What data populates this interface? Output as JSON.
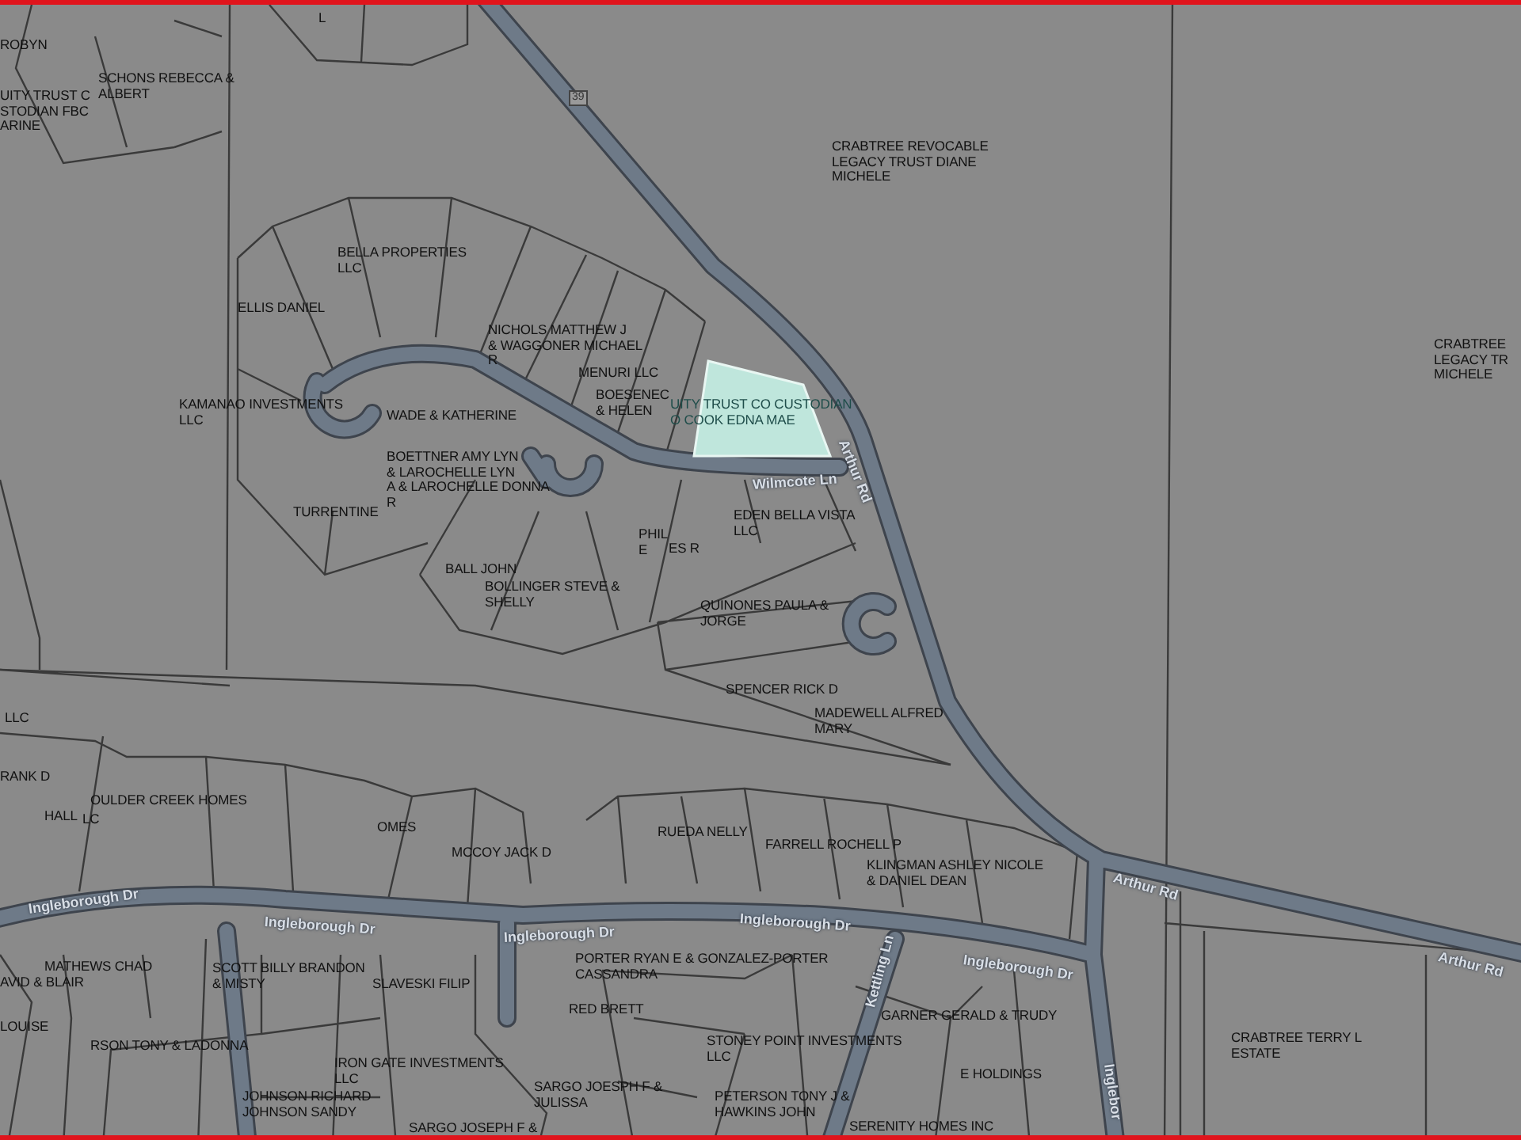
{
  "map": {
    "route_shield": "39",
    "road_labels": [
      {
        "text": "Wilmcote Ln"
      },
      {
        "text": "Arthur Rd"
      },
      {
        "text": "Ingleborough Dr"
      },
      {
        "text": "Ingleborough Dr"
      },
      {
        "text": "Ingleborough Dr"
      },
      {
        "text": "Ingleborough Dr"
      },
      {
        "text": "Ingleborough Dr"
      },
      {
        "text": "Inglebor"
      },
      {
        "text": "Arthur Rd"
      },
      {
        "text": "Arthur Rd"
      },
      {
        "text": "Kettling Ln"
      }
    ],
    "parcels": [
      {
        "owner": "ROBYN",
        "selected": false
      },
      {
        "owner": "SCHONS REBECCA &\nALBERT",
        "selected": false
      },
      {
        "owner": "UITY TRUST C\nSTODIAN FBC\nARINE",
        "selected": false
      },
      {
        "owner": "L",
        "selected": false
      },
      {
        "owner": "BELLA PROPERTIES\nLLC",
        "selected": false
      },
      {
        "owner": "ELLIS DANIEL",
        "selected": false
      },
      {
        "owner": "NICHOLS MATTHEW J\n& WAGGONER MICHAEL\nR",
        "selected": false
      },
      {
        "owner": "MENURI LLC",
        "selected": false
      },
      {
        "owner": "CRABTREE REVOCABLE\nLEGACY TRUST DIANE\nMICHELE",
        "selected": false
      },
      {
        "owner": "CRABTREE\nLEGACY TR\nMICHELE",
        "selected": false
      },
      {
        "owner": "KAMANAO INVESTMENTS\nLLC",
        "selected": false
      },
      {
        "owner": "WADE & KATHERINE",
        "selected": false
      },
      {
        "owner": "BOESENEC\n& HELEN",
        "selected": false
      },
      {
        "owner": "UITY TRUST CO CUSTODIAN\nO COOK EDNA MAE",
        "selected": true
      },
      {
        "owner": "BOETTNER AMY LYN\n& LAROCHELLE LYN\nA & LAROCHELLE DONNA\nR",
        "selected": false
      },
      {
        "owner": "TURRENTINE",
        "selected": false
      },
      {
        "owner": "EDEN BELLA VISTA\nLLC",
        "selected": false
      },
      {
        "owner": "PHIL\nE",
        "selected": false
      },
      {
        "owner": "ES R",
        "selected": false
      },
      {
        "owner": "BALL JOHN",
        "selected": false
      },
      {
        "owner": "BOLLINGER STEVE &\nSHELLY",
        "selected": false
      },
      {
        "owner": "QUINONES PAULA &\nJORGE",
        "selected": false
      },
      {
        "owner": "SPENCER RICK D",
        "selected": false
      },
      {
        "owner": "LLC",
        "selected": false
      },
      {
        "owner": "MADEWELL ALFRED\nMARY",
        "selected": false
      },
      {
        "owner": "RANK D",
        "selected": false
      },
      {
        "owner": "HALL",
        "selected": false
      },
      {
        "owner": "OULDER CREEK HOMES",
        "selected": false
      },
      {
        "owner": "LC",
        "selected": false
      },
      {
        "owner": "OMES",
        "selected": false
      },
      {
        "owner": "MCCOY JACK D",
        "selected": false
      },
      {
        "owner": "RUEDA NELLY",
        "selected": false
      },
      {
        "owner": "FARRELL ROCHELL P",
        "selected": false
      },
      {
        "owner": "KLINGMAN ASHLEY NICOLE\n& DANIEL DEAN",
        "selected": false
      },
      {
        "owner": "MATHEWS CHAD",
        "selected": false
      },
      {
        "owner": "AVID & BLAIR",
        "selected": false
      },
      {
        "owner": "SCOTT BILLY BRANDON\n& MISTY",
        "selected": false
      },
      {
        "owner": "SLAVESKI FILIP",
        "selected": false
      },
      {
        "owner": "PORTER RYAN E & GONZALEZ-PORTER\nCASSANDRA",
        "selected": false
      },
      {
        "owner": "RED BRETT",
        "selected": false
      },
      {
        "owner": "LOUISE",
        "selected": false
      },
      {
        "owner": "RSON TONY & LADONNA",
        "selected": false
      },
      {
        "owner": "IRON GATE INVESTMENTS\nLLC",
        "selected": false
      },
      {
        "owner": "JOHNSON RICHARD\nJOHNSON SANDY",
        "selected": false
      },
      {
        "owner": "SARGO JOESPH F &\nJULISSA",
        "selected": false
      },
      {
        "owner": "SARGO JOSEPH F &",
        "selected": false
      },
      {
        "owner": "STONEY POINT INVESTMENTS\nLLC",
        "selected": false
      },
      {
        "owner": "PETERSON TONY J &\nHAWKINS JOHN",
        "selected": false
      },
      {
        "owner": "GARNER GERALD & TRUDY",
        "selected": false
      },
      {
        "owner": "E HOLDINGS",
        "selected": false
      },
      {
        "owner": "SERENITY HOMES INC",
        "selected": false
      },
      {
        "owner": "CRABTREE TERRY L\nESTATE",
        "selected": false
      }
    ]
  }
}
